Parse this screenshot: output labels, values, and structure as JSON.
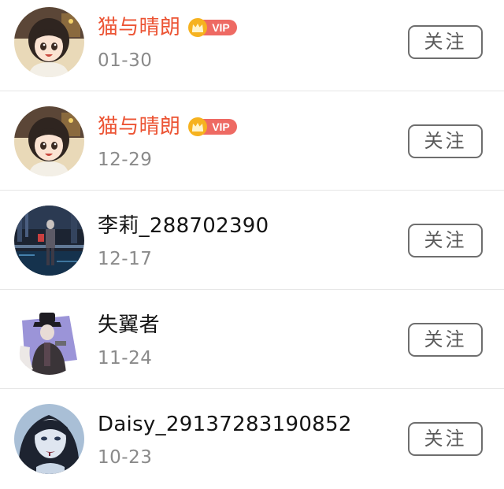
{
  "follow_list": [
    {
      "avatar": "anime-girl-avatar",
      "name": "猫与晴朗",
      "vip": true,
      "vip_label": "VIP",
      "date": "01-30",
      "button_label": "关注"
    },
    {
      "avatar": "anime-girl-avatar",
      "name": "猫与晴朗",
      "vip": true,
      "vip_label": "VIP",
      "date": "12-29",
      "button_label": "关注"
    },
    {
      "avatar": "dark-city-figure-avatar",
      "name": "李莉_288702390",
      "vip": false,
      "date": "12-17",
      "button_label": "关注"
    },
    {
      "avatar": "anime-man-hat-avatar",
      "name": "失翼者",
      "vip": false,
      "date": "11-24",
      "button_label": "关注"
    },
    {
      "avatar": "dark-hair-girl-avatar",
      "name": "Daisy_29137283190852",
      "vip": false,
      "date": "10-23",
      "button_label": "关注"
    }
  ],
  "colors": {
    "vip_name": "#ec5434",
    "vip_badge": "#ee6a63",
    "crown": "#f6b21f",
    "name": "#141414",
    "date": "#8a8a8a",
    "button_border": "#6e6e6e",
    "divider": "#e6e6e6"
  }
}
